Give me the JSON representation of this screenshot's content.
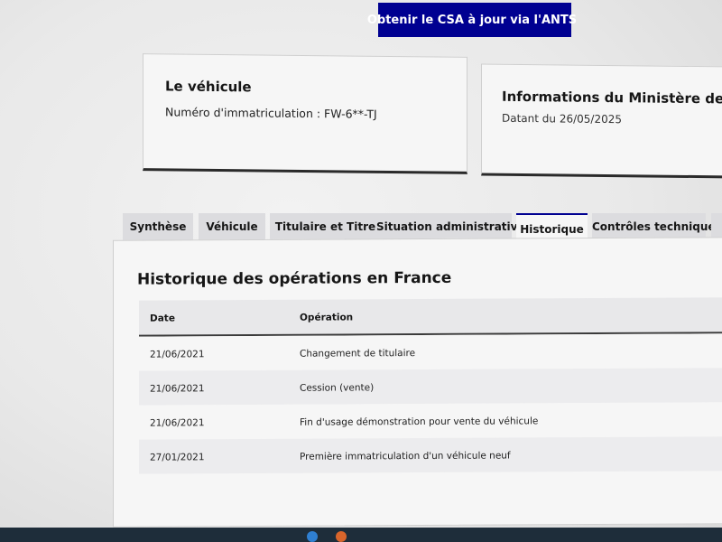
{
  "header": {
    "ants_button_label": "Obtenir le CSA à jour via l'ANTS"
  },
  "vehicle_card": {
    "title": "Le véhicule",
    "plate_line": "Numéro d'immatriculation : FW-6**-TJ"
  },
  "ministere_card": {
    "title": "Informations du Ministère de l'Intérieu",
    "date_line": "Datant du 26/05/2025"
  },
  "tabs": [
    {
      "label": "Synthèse",
      "active": false
    },
    {
      "label": "Véhicule",
      "active": false
    },
    {
      "label": "Titulaire et Titre",
      "active": false
    },
    {
      "label": "Situation administrative",
      "active": false
    },
    {
      "label": "Historique",
      "active": true
    },
    {
      "label": "Contrôles techniques",
      "active": false
    }
  ],
  "historique": {
    "title": "Historique des opérations en France",
    "columns": [
      "Date",
      "Opération"
    ],
    "rows": [
      {
        "date": "21/06/2021",
        "operation": "Changement de titulaire"
      },
      {
        "date": "21/06/2021",
        "operation": "Cession (vente)"
      },
      {
        "date": "21/06/2021",
        "operation": "Fin d'usage démonstration pour vente du véhicule"
      },
      {
        "date": "27/01/2021",
        "operation": "Première immatriculation d'un véhicule neuf"
      }
    ]
  },
  "colors": {
    "accent": "#000091",
    "panel_bg": "#f6f6f6",
    "tab_bg": "#dcdcdf"
  }
}
